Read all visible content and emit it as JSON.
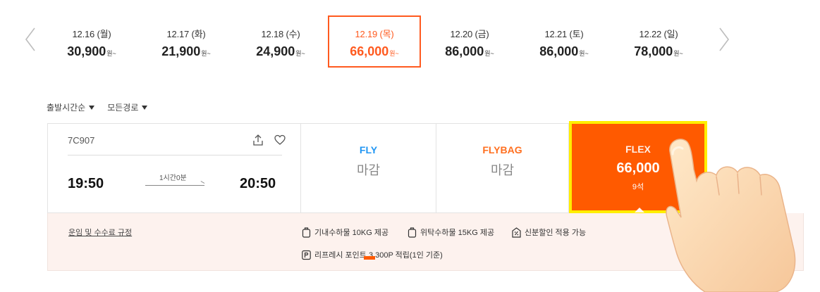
{
  "dates": [
    {
      "date": "12.16 (월)",
      "price": "30,900",
      "unit": "원~"
    },
    {
      "date": "12.17 (화)",
      "price": "21,900",
      "unit": "원~"
    },
    {
      "date": "12.18 (수)",
      "price": "24,900",
      "unit": "원~"
    },
    {
      "date": "12.19 (목)",
      "price": "66,000",
      "unit": "원~"
    },
    {
      "date": "12.20 (금)",
      "price": "86,000",
      "unit": "원~"
    },
    {
      "date": "12.21 (토)",
      "price": "86,000",
      "unit": "원~"
    },
    {
      "date": "12.22 (일)",
      "price": "78,000",
      "unit": "원~"
    }
  ],
  "filters": {
    "sort": "출발시간순",
    "route": "모든경로"
  },
  "flight": {
    "number": "7C907",
    "departure": "19:50",
    "arrival": "20:50",
    "duration": "1시간0분"
  },
  "fares": {
    "fly": {
      "name": "FLY",
      "status": "마감"
    },
    "flybag": {
      "name": "FLYBAG",
      "status": "마감"
    },
    "flex": {
      "name": "FLEX",
      "price": "66,000",
      "seats": "9석"
    }
  },
  "details": {
    "rules_link": "운임 및 수수료 규정",
    "features": [
      "기내수하물 10KG 제공",
      "위탁수하물 15KG 제공",
      "신분할인 적용 가능",
      "리프레시 포인트 3,300P 적립(1인 기준)"
    ]
  },
  "colors": {
    "accent": "#ff5a00",
    "fly": "#2196f3",
    "flybag": "#ff6f1f",
    "highlight": "#ffee00"
  },
  "icons": [
    "chevron-left-icon",
    "chevron-right-icon",
    "share-icon",
    "heart-icon",
    "carry-on-bag-icon",
    "checked-bag-icon",
    "id-discount-icon",
    "point-icon",
    "hand-cursor-icon"
  ]
}
